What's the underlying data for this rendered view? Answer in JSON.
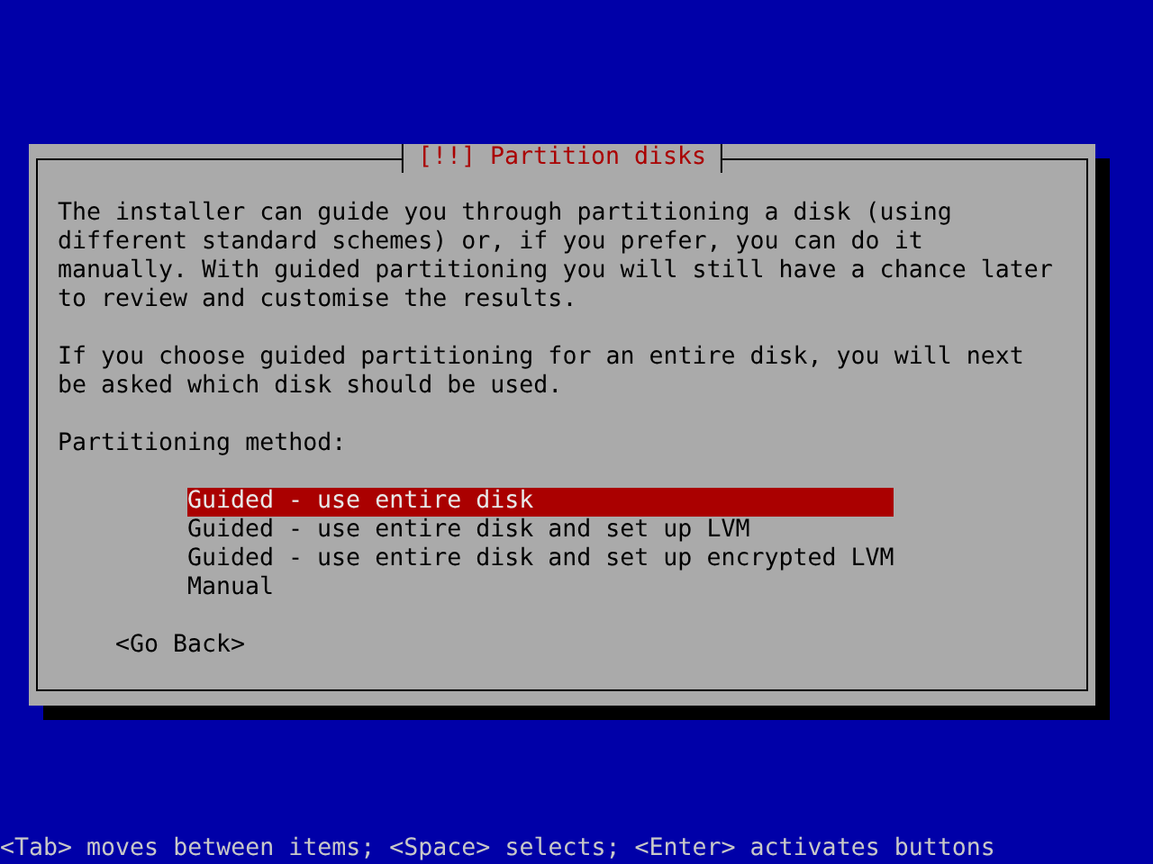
{
  "dialog": {
    "title": "[!!] Partition disks",
    "paragraphs": [
      "The installer can guide you through partitioning a disk (using different standard schemes) or, if you prefer, you can do it manually. With guided partitioning you will still have a chance later to review and customise the results.",
      "If you choose guided partitioning for an entire disk, you will next be asked which disk should be used."
    ],
    "prompt": "Partitioning method:",
    "options": [
      {
        "label": "Guided - use entire disk",
        "selected": true
      },
      {
        "label": "Guided - use entire disk and set up LVM",
        "selected": false
      },
      {
        "label": "Guided - use entire disk and set up encrypted LVM",
        "selected": false
      },
      {
        "label": "Manual",
        "selected": false
      }
    ],
    "buttons": [
      "<Go Back>"
    ]
  },
  "status_bar": "<Tab> moves between items; <Space> selects; <Enter> activates buttons"
}
